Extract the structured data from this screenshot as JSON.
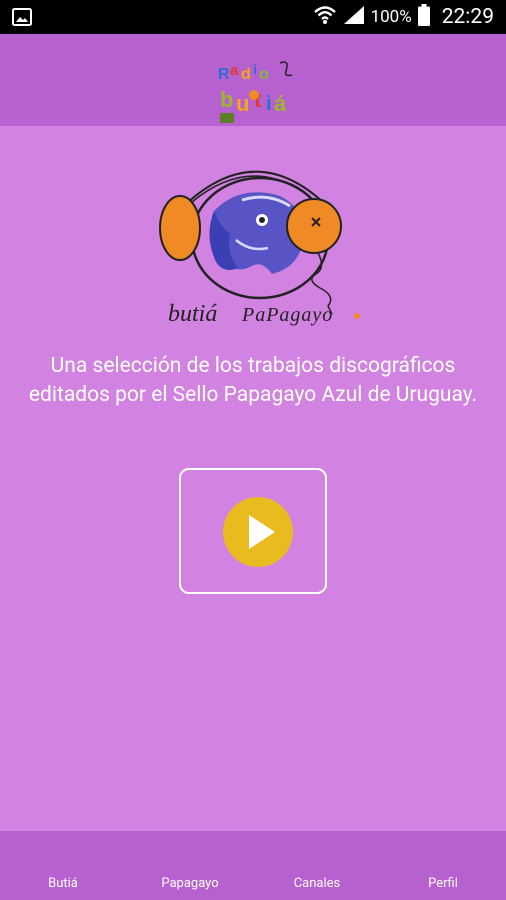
{
  "status_bar": {
    "battery_percent": "100%",
    "time": "22:29"
  },
  "description": "Una selección de los trabajos discográficos editados por el Sello Papagayo Azul de Uruguay.",
  "bottom_nav": {
    "items": [
      "Butiá",
      "Papagayo",
      "Canales",
      "Perfil"
    ]
  },
  "logo_text": {
    "app_logo": "Radio Butiá",
    "hero_logo": "butiá Papagayo"
  },
  "colors": {
    "background": "#d282e0",
    "bars": "#b760cf",
    "play_button": "#e9bb1f",
    "headphones_orange": "#f08a24"
  }
}
